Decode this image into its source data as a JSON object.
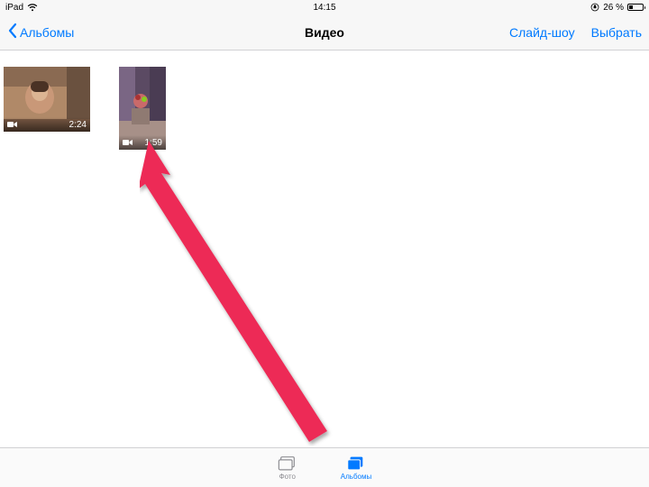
{
  "status": {
    "device": "iPad",
    "time": "14:15",
    "battery_pct": "26 %"
  },
  "nav": {
    "back_label": "Альбомы",
    "title": "Видео",
    "slideshow": "Слайд-шоу",
    "select": "Выбрать"
  },
  "videos": [
    {
      "duration": "2:24"
    },
    {
      "duration": "1:59"
    }
  ],
  "tabs": {
    "photos": "Фото",
    "albums": "Альбомы"
  }
}
